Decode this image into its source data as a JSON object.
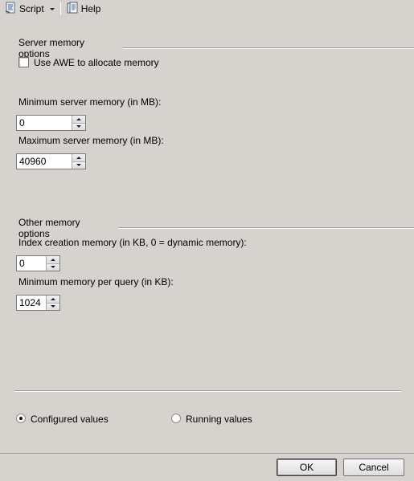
{
  "toolbar": {
    "script_label": "Script",
    "help_label": "Help"
  },
  "server_memory": {
    "header": "Server memory options",
    "awe_label": "Use AWE to allocate memory",
    "awe_checked": false,
    "min_label": "Minimum server memory (in MB):",
    "min_value": "0",
    "max_label": "Maximum server memory (in MB):",
    "max_value": "40960"
  },
  "other_memory": {
    "header": "Other memory options",
    "index_label": "Index creation memory (in KB, 0 = dynamic memory):",
    "index_value": "0",
    "query_label": "Minimum memory per query (in KB):",
    "query_value": "1024"
  },
  "values_mode": {
    "configured_label": "Configured values",
    "running_label": "Running values",
    "selected": "configured"
  },
  "dialog": {
    "ok_label": "OK",
    "cancel_label": "Cancel"
  }
}
